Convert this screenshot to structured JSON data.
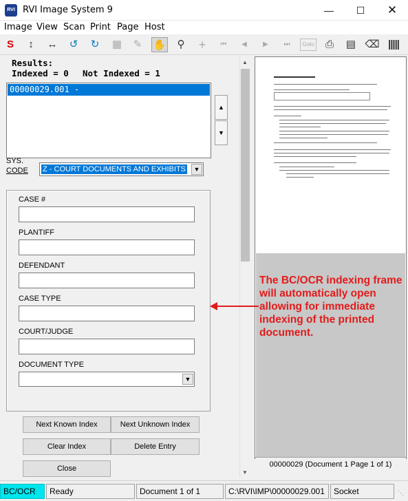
{
  "window": {
    "title": "RVI Image System 9",
    "icon_text": "RVI"
  },
  "menu": [
    "Image",
    "View",
    "Scan",
    "Print",
    "Page",
    "Host"
  ],
  "toolbar": {
    "goto_label": "Goto",
    "icons": [
      "s-icon",
      "vertical-arrow-icon",
      "horizontal-arrow-icon",
      "rotate-left-icon",
      "rotate-right-icon",
      "pages-icon",
      "edit-image-icon",
      "hand-icon",
      "zoom-icon",
      "crosshair-icon",
      "first-page-icon",
      "prev-page-icon",
      "next-page-icon",
      "last-page-icon",
      "goto-icon",
      "print-icon",
      "scanner-icon",
      "stamp-icon",
      "barcode-icon"
    ]
  },
  "results": {
    "title": "Results:",
    "indexed_label": "Indexed = 0",
    "not_indexed_label": "Not Indexed = 1",
    "items": [
      "00000029.001 -"
    ]
  },
  "syscode": {
    "label_line1": "SYS.",
    "label_line2": "CODE",
    "value": "Z - COURT DOCUMENTS AND EXHIBITS"
  },
  "fields": [
    {
      "label": "CASE #",
      "value": ""
    },
    {
      "label": "PLANTIFF",
      "value": ""
    },
    {
      "label": "DEFENDANT",
      "value": ""
    },
    {
      "label": "CASE TYPE",
      "value": ""
    },
    {
      "label": "COURT/JUDGE",
      "value": ""
    },
    {
      "label": "DOCUMENT TYPE",
      "value": ""
    }
  ],
  "buttons": {
    "next_known": "Next Known Index",
    "next_unknown": "Next Unknown Index",
    "clear_index": "Clear Index",
    "delete_entry": "Delete Entry",
    "close": "Close"
  },
  "preview": {
    "doc_info": "00000029 (Document 1 Page 1 of 1)"
  },
  "callout": "The BC/OCR indexing frame will automatically open allowing for immediate indexing of the printed document.",
  "status": {
    "mode": "BC/OCR",
    "state": "Ready",
    "document": "Document 1 of 1",
    "path": "C:\\RVI\\IMP\\00000029.001",
    "connection": "Socket"
  },
  "colors": {
    "accent": "#0078d7",
    "callout": "#e21b1b",
    "status_mode_bg": "#00e5ee"
  }
}
